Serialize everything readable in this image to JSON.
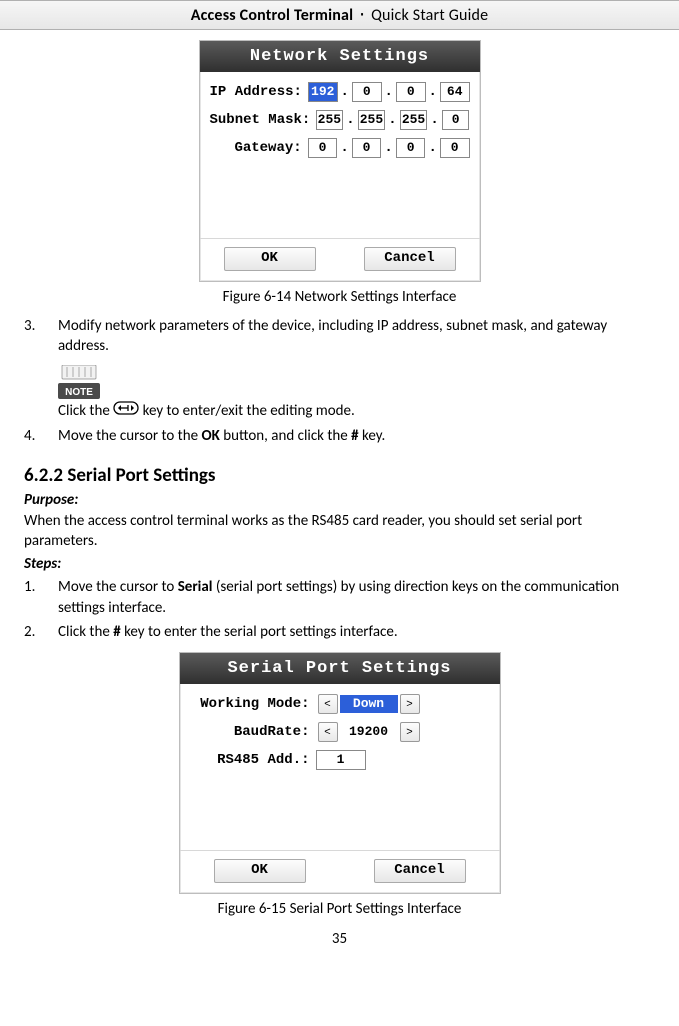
{
  "header": {
    "title_bold": "Access Control Terminal",
    "separator": "·",
    "title_rest": "Quick Start Guide"
  },
  "figure1": {
    "dialog_title": "Network Settings",
    "fields": {
      "ip_label": "IP Address:",
      "ip": [
        "192",
        "0",
        "0",
        "64"
      ],
      "subnet_label": "Subnet Mask:",
      "subnet": [
        "255",
        "255",
        "255",
        "0"
      ],
      "gateway_label": "Gateway:",
      "gateway": [
        "0",
        "0",
        "0",
        "0"
      ]
    },
    "ok": "OK",
    "cancel": "Cancel",
    "caption_prefix": "Figure 6-14",
    "caption_text": "Network Settings Interface"
  },
  "step3": {
    "num": "3.",
    "text": "Modify network parameters of the device, including IP address, subnet mask, and gateway address."
  },
  "note_line_pre": "Click the ",
  "note_line_post": " key to enter/exit the editing mode.",
  "step4": {
    "num": "4.",
    "text_pre": "Move the cursor to the ",
    "ok": "OK",
    "text_mid": " button, and click the ",
    "hash": "#",
    "text_post": " key."
  },
  "section": {
    "number": "6.2.2",
    "title": "Serial Port Settings"
  },
  "purpose_label": "Purpose:",
  "purpose_text": "When the access control terminal works as the RS485 card reader, you should set serial port parameters.",
  "steps_label": "Steps:",
  "sp_step1": {
    "num": "1.",
    "pre": "Move the cursor to ",
    "bold": "Serial",
    "post": " (serial port settings) by using direction keys on the communication settings interface."
  },
  "sp_step2": {
    "num": "2.",
    "pre": "Click the ",
    "hash": "#",
    "post": " key to enter the serial port settings interface."
  },
  "figure2": {
    "dialog_title": "Serial Port Settings",
    "fields": {
      "mode_label": "Working Mode:",
      "mode_value": "Down",
      "baud_label": "BaudRate:",
      "baud_value": "19200",
      "addr_label": "RS485 Add.:",
      "addr_value": "1"
    },
    "ok": "OK",
    "cancel": "Cancel",
    "caption_prefix": "Figure 6-15",
    "caption_text": "Serial Port Settings Interface"
  },
  "page_number": "35"
}
